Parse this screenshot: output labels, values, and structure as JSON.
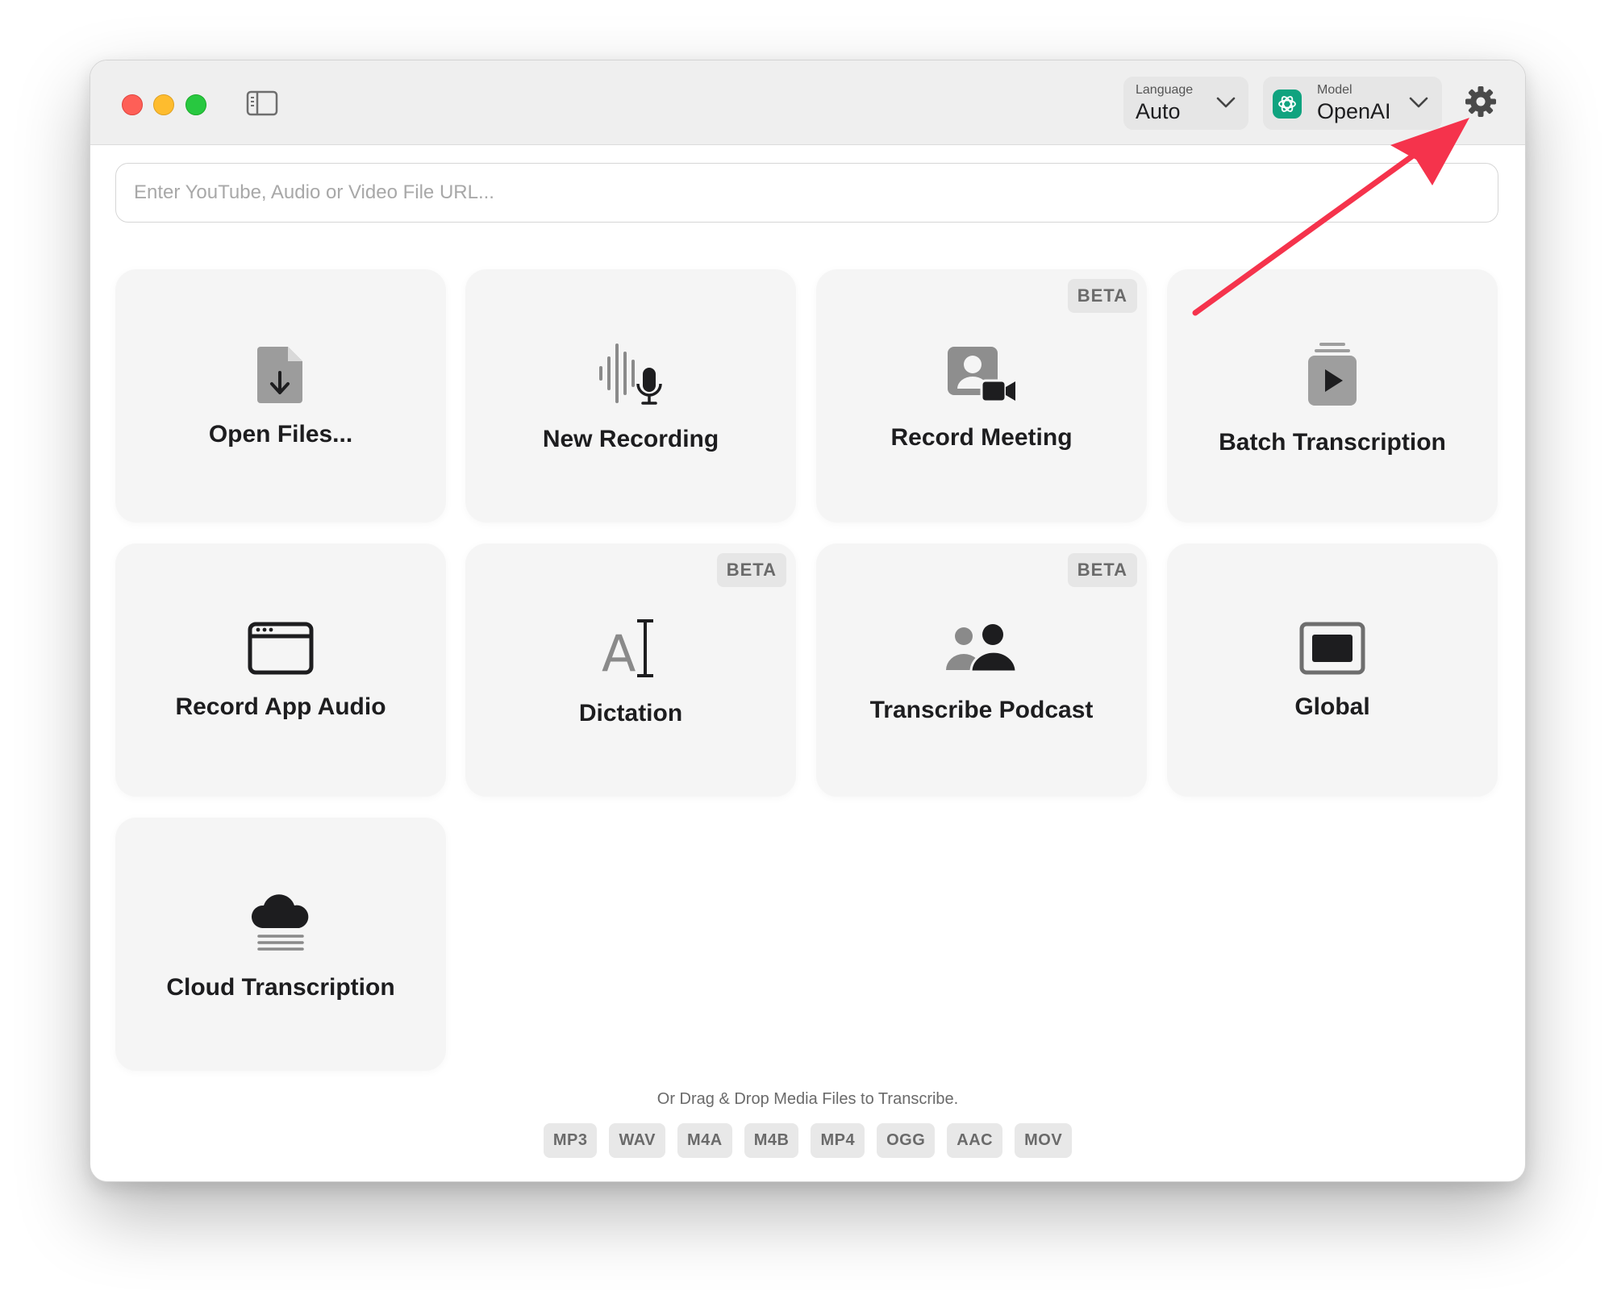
{
  "toolbar": {
    "language": {
      "label": "Language",
      "value": "Auto"
    },
    "model": {
      "label": "Model",
      "value": "OpenAI"
    }
  },
  "search": {
    "placeholder": "Enter YouTube, Audio or Video File URL..."
  },
  "cards": [
    {
      "label": "Open Files...",
      "icon": "document-download-icon"
    },
    {
      "label": "New Recording",
      "icon": "waveform-mic-icon"
    },
    {
      "label": "Record Meeting",
      "icon": "person-video-icon",
      "badge": "BETA"
    },
    {
      "label": "Batch Transcription",
      "icon": "stacked-play-icon"
    },
    {
      "label": "Record App Audio",
      "icon": "app-window-icon"
    },
    {
      "label": "Dictation",
      "icon": "text-cursor-icon",
      "badge": "BETA",
      "icon_text": "A"
    },
    {
      "label": "Transcribe Podcast",
      "icon": "people-icon",
      "badge": "BETA"
    },
    {
      "label": "Global",
      "icon": "display-icon"
    },
    {
      "label": "Cloud Transcription",
      "icon": "cloud-fog-icon"
    }
  ],
  "footer": {
    "text": "Or Drag & Drop Media Files to Transcribe.",
    "formats": [
      "MP3",
      "WAV",
      "M4A",
      "M4B",
      "MP4",
      "OGG",
      "AAC",
      "MOV"
    ]
  },
  "colors": {
    "accent_arrow": "#f5334c",
    "openai_green": "#10a37f",
    "traffic_red": "#fe5f57",
    "traffic_yellow": "#febc2e",
    "traffic_green": "#28c840"
  }
}
